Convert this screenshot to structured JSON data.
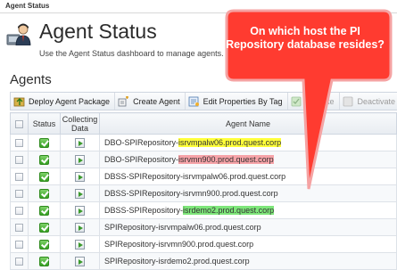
{
  "breadcrumb": "Agent Status",
  "header": {
    "title": "Agent Status",
    "description": "Use the Agent Status dashboard to manage agents. To deploy agent packages to remote h"
  },
  "section": {
    "title": "Agents"
  },
  "toolbar": {
    "deploy_label": "Deploy Agent Package",
    "create_label": "Create Agent",
    "edit_label": "Edit Properties By Tag",
    "activate_label": "Activate",
    "deactivate_label": "Deactivate"
  },
  "table": {
    "columns": {
      "status": "Status",
      "collecting_line1": "Collecting",
      "collecting_line2": "Data",
      "agent_name": "Agent Name"
    },
    "rows": [
      {
        "prefix": "DBO-SPIRepository-",
        "host": "isrvmpalw06.prod.quest.corp",
        "highlight": "yellow"
      },
      {
        "prefix": "DBO-SPIRepository-",
        "host": "isrvmn900.prod.quest.corp",
        "highlight": "pink"
      },
      {
        "prefix": "DBSS-SPIRepository-",
        "host": "isrvmpalw06.prod.quest.corp",
        "highlight": ""
      },
      {
        "prefix": "DBSS-SPIRepository-",
        "host": "isrvmn900.prod.quest.corp",
        "highlight": ""
      },
      {
        "prefix": "DBSS-SPIRepository-",
        "host": "isrdemo2.prod.quest.corp",
        "highlight": "green"
      },
      {
        "prefix": "SPIRepository-",
        "host": "isrvmpalw06.prod.quest.corp",
        "highlight": ""
      },
      {
        "prefix": "SPIRepository-",
        "host": "isrvmn900.prod.quest.corp",
        "highlight": ""
      },
      {
        "prefix": "SPIRepository-",
        "host": "isrdemo2.prod.quest.corp",
        "highlight": ""
      }
    ]
  },
  "callout": {
    "text": "On which host the PI Repository database resides?",
    "fill_color": "#ff3b30",
    "border_color": "#f5a3a3"
  }
}
